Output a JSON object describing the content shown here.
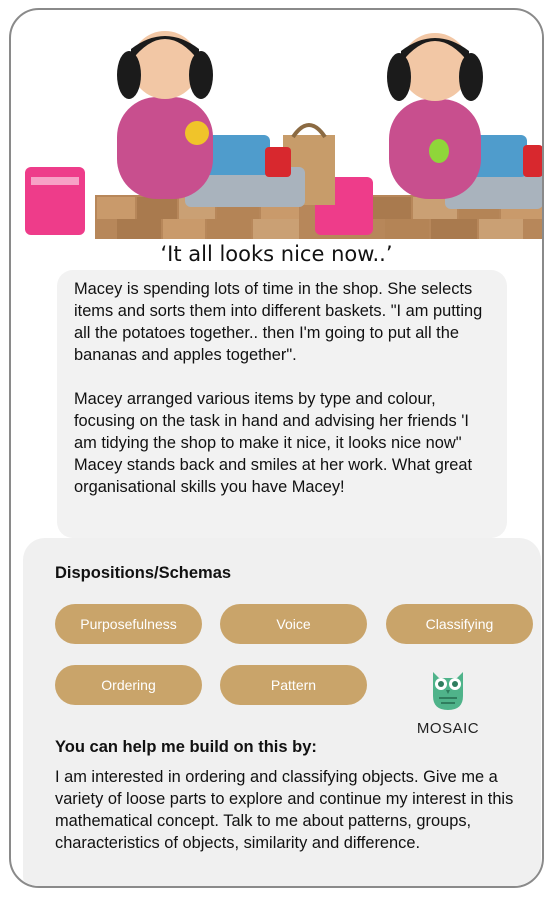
{
  "story": {
    "title": "‘It all looks nice now..’",
    "paragraph_1": "Macey is spending lots of time in the shop. She selects items and sorts them into different baskets. \"I am putting all the potatoes together.. then I'm going to put all the bananas and apples together\".",
    "paragraph_2": "Macey arranged various items by type and colour, focusing on the task in hand and advising her friends 'I am tidying the shop to make it nice, it looks nice now\" Macey stands back and smiles at her work. What great organisational skills you have Macey!"
  },
  "dispositions": {
    "heading": "Dispositions/Schemas",
    "tags": [
      "Purposefulness",
      "Voice",
      "Classifying",
      "Ordering",
      "Pattern"
    ]
  },
  "logo": {
    "text": "MOSAIC",
    "icon": "owl-icon"
  },
  "help": {
    "heading": "You can help me build on this by:",
    "text": "I am interested in ordering and classifying objects. Give me a variety of loose parts to explore and continue my interest in this mathematical concept. Talk to me about patterns, groups, characteristics of objects, similarity and difference."
  },
  "colors": {
    "pill": "#c9a46a",
    "panel": "#f0f0f0",
    "bubble": "#f2f2f2",
    "border": "#8a8a8a",
    "owl_green": "#4fb38a"
  }
}
